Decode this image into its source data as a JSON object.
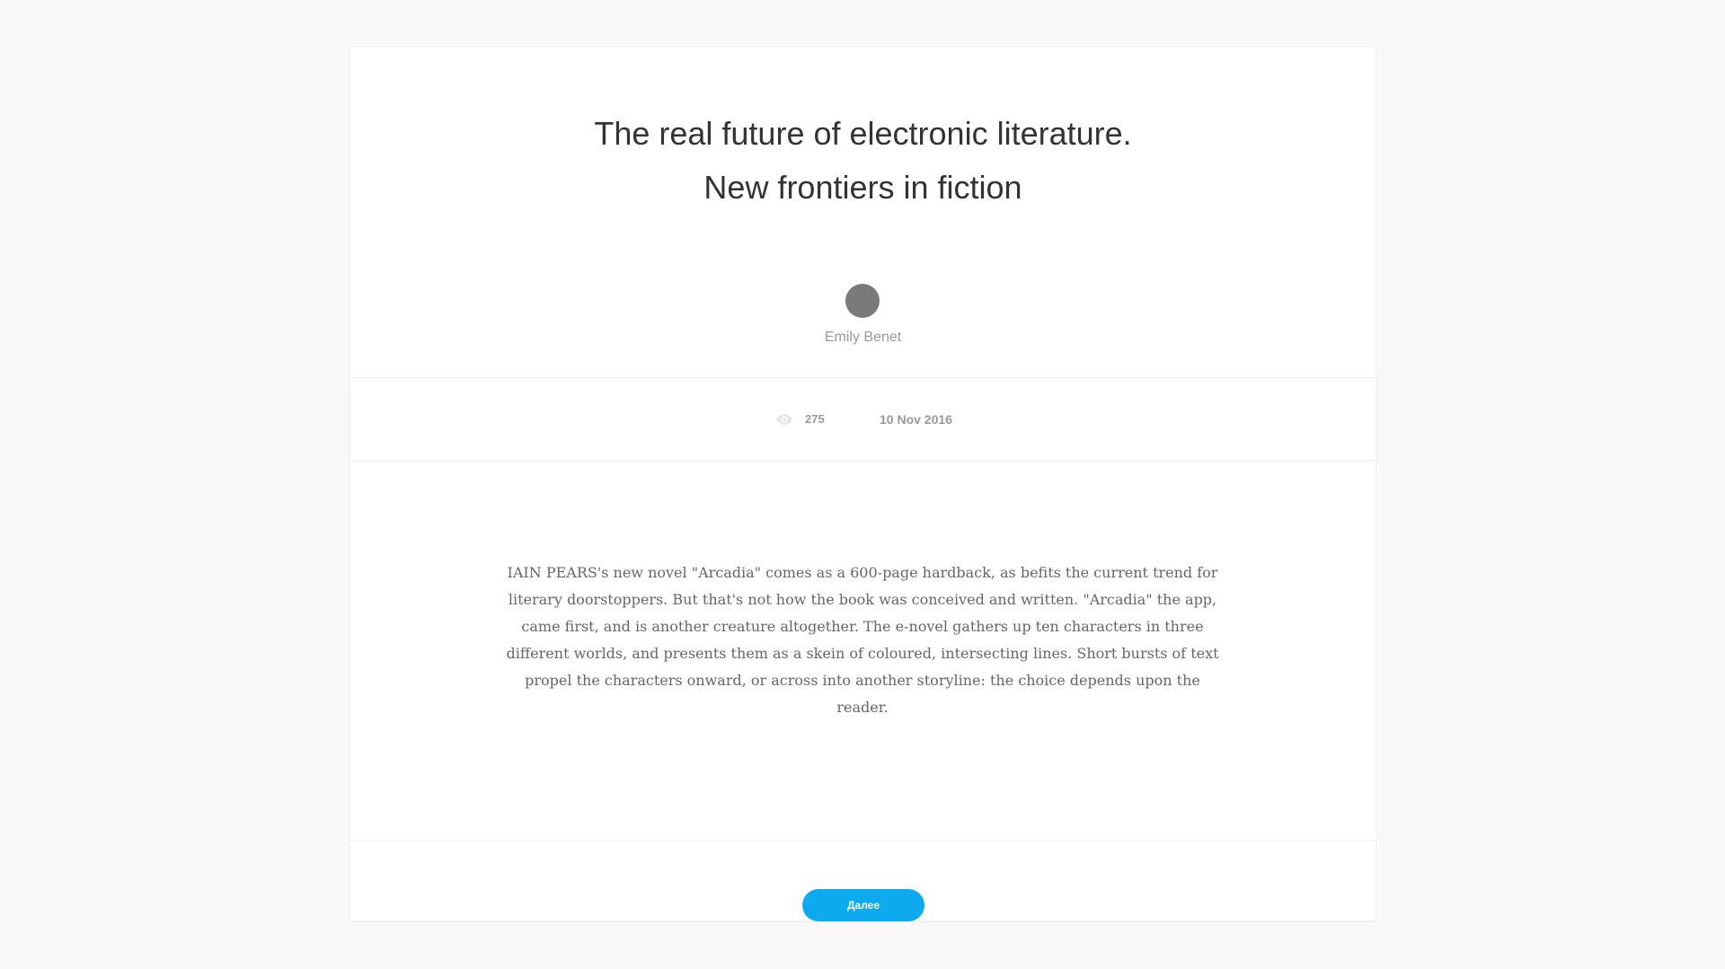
{
  "article": {
    "title_line1": "The real future of electronic literature.",
    "title_line2": "New frontiers in fiction",
    "author": "Emily Benet",
    "views": "275",
    "date": "10 Nov 2016",
    "body": "IAIN PEARS's new novel \"Arcadia\" comes as a 600-page hardback, as befits the current trend for literary doorstoppers. But that's not how the book was conceived and written. \"Arcadia\" the app, came first, and is another creature altogether. The e-novel gathers up ten characters in three different worlds, and presents them as a skein of coloured, intersecting lines. Short bursts of text propel the characters onward, or across into another storyline: the choice depends upon the reader."
  },
  "actions": {
    "next_label": "Далее"
  },
  "icons": {
    "views": "eye-icon"
  },
  "colors": {
    "accent": "#0eaaf0",
    "avatar": "#7a7a7a"
  }
}
